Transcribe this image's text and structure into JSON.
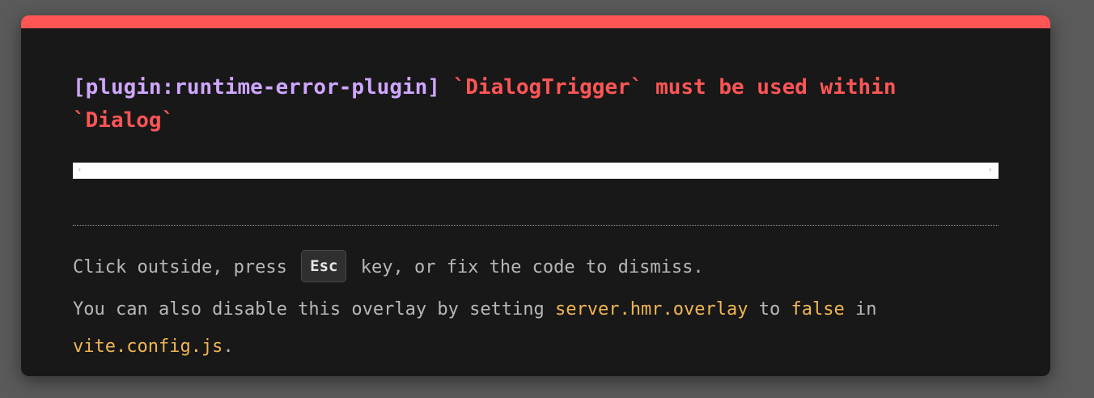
{
  "error": {
    "plugin": "[plugin:runtime-error-plugin]",
    "message": "`DialogTrigger` must be used within `Dialog`"
  },
  "frame": {
    "scroll_left": "‹",
    "scroll_right": "›"
  },
  "tip": {
    "line1_before": "Click outside, press",
    "key": "Esc",
    "line1_after": "key, or fix the code to dismiss.",
    "line2_before": "You can also disable this overlay by setting",
    "config_key": "server.hmr.overlay",
    "line2_to": "to",
    "config_value": "false",
    "line2_in": "in",
    "config_file": "vite.config.js",
    "line2_end": "."
  },
  "colors": {
    "accent_red": "#ff5555",
    "plugin_purple": "#cfa6ff",
    "code_yellow": "#f0b552",
    "background": "#181818"
  }
}
